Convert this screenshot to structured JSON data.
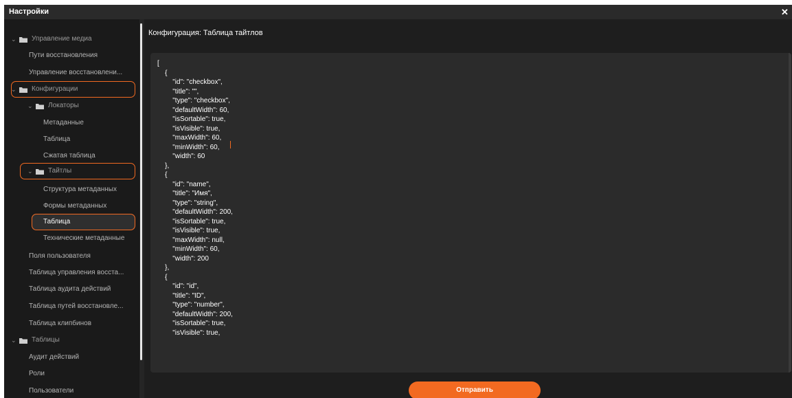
{
  "window": {
    "title": "Настройки",
    "close_icon": "close-icon"
  },
  "sidebar": {
    "items": [
      {
        "label": "Управление медиа",
        "kind": "folder",
        "icon": "folder-icon"
      },
      {
        "label": "Пути восстановления",
        "kind": "leaf"
      },
      {
        "label": "Управление восстановлени...",
        "kind": "leaf"
      },
      {
        "label": "Конфигурации",
        "kind": "folder",
        "icon": "folder-icon"
      },
      {
        "label": "Локаторы",
        "kind": "folder",
        "icon": "folder-icon"
      },
      {
        "label": "Метаданные",
        "kind": "leaf"
      },
      {
        "label": "Таблица",
        "kind": "leaf"
      },
      {
        "label": "Сжатая таблица",
        "kind": "leaf"
      },
      {
        "label": "Тайтлы",
        "kind": "folder",
        "icon": "folder-icon"
      },
      {
        "label": "Структура метаданных",
        "kind": "leaf"
      },
      {
        "label": "Формы метаданных",
        "kind": "leaf"
      },
      {
        "label": "Таблица",
        "kind": "leaf",
        "selected": true
      },
      {
        "label": "Технические метаданные",
        "kind": "leaf"
      },
      {
        "label": "Поля пользователя",
        "kind": "leaf"
      },
      {
        "label": "Таблица управления восста...",
        "kind": "leaf"
      },
      {
        "label": "Таблица аудита действий",
        "kind": "leaf"
      },
      {
        "label": "Таблица путей восстановле...",
        "kind": "leaf"
      },
      {
        "label": "Таблица клипбинов",
        "kind": "leaf"
      },
      {
        "label": "Таблицы",
        "kind": "folder",
        "icon": "folder-icon"
      },
      {
        "label": "Аудит действий",
        "kind": "leaf"
      },
      {
        "label": "Роли",
        "kind": "leaf"
      },
      {
        "label": "Пользователи",
        "kind": "leaf"
      }
    ]
  },
  "main": {
    "title": "Конфигурация: Таблица тайтлов",
    "editor_text": "[\n\t{\n\t\t\"id\": \"checkbox\",\n\t\t\"title\": \"\",\n\t\t\"type\": \"checkbox\",\n\t\t\"defaultWidth\": 60,\n\t\t\"isSortable\": true,\n\t\t\"isVisible\": true,\n\t\t\"maxWidth\": 60,\n\t\t\"minWidth\": 60,\n\t\t\"width\": 60\n\t},\n\t{\n\t\t\"id\": \"name\",\n\t\t\"title\": \"Имя\",\n\t\t\"type\": \"string\",\n\t\t\"defaultWidth\": 200,\n\t\t\"isSortable\": true,\n\t\t\"isVisible\": true,\n\t\t\"maxWidth\": null,\n\t\t\"minWidth\": 60,\n\t\t\"width\": 200\n\t},\n\t{\n\t\t\"id\": \"id\",\n\t\t\"title\": \"ID\",\n\t\t\"type\": \"number\",\n\t\t\"defaultWidth\": 200,\n\t\t\"isSortable\": true,\n\t\t\"isVisible\": true,",
    "submit_label": "Отправить"
  },
  "colors": {
    "accent": "#f26a21",
    "background": "#1e1e1e",
    "editor": "#2b2b2b"
  }
}
